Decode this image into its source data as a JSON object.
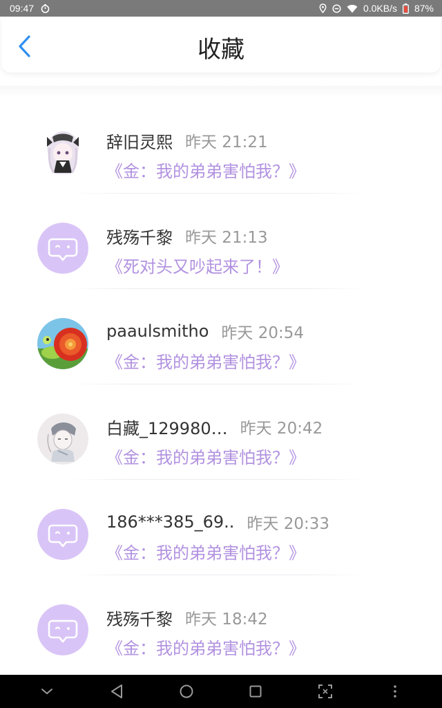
{
  "status_bar": {
    "time": "09:47",
    "network_speed": "0.0KB/s",
    "battery": "87%"
  },
  "header": {
    "title": "收藏",
    "accent_color": "#2f8ff0"
  },
  "items": [
    {
      "name": "辞旧灵熙",
      "time": "昨天 21:21",
      "message": "《金：我的弟弟害怕我？》",
      "avatar": "anime-girl-avatar"
    },
    {
      "name": "残殇千黎",
      "time": "昨天 21:13",
      "message": "《死对头又吵起来了！》",
      "avatar": "default-chat-bubble-avatar"
    },
    {
      "name": "paaulsmitho",
      "time": "昨天 20:54",
      "message": "《金：我的弟弟害怕我？》",
      "avatar": "snail-avatar"
    },
    {
      "name": "白藏_129980…",
      "time": "昨天 20:42",
      "message": "《金：我的弟弟害怕我？》",
      "avatar": "sketch-character-avatar"
    },
    {
      "name": "186***385_69..",
      "time": "昨天 20:33",
      "message": "《金：我的弟弟害怕我？》",
      "avatar": "default-chat-bubble-avatar"
    },
    {
      "name": "残殇千黎",
      "time": "昨天 18:42",
      "message": "《金：我的弟弟害怕我？》",
      "avatar": "default-chat-bubble-avatar"
    }
  ],
  "colors": {
    "message_purple": "#b292e0",
    "avatar_lavender": "#d9c4f7",
    "status_bar_gray": "#7a7a7a"
  }
}
